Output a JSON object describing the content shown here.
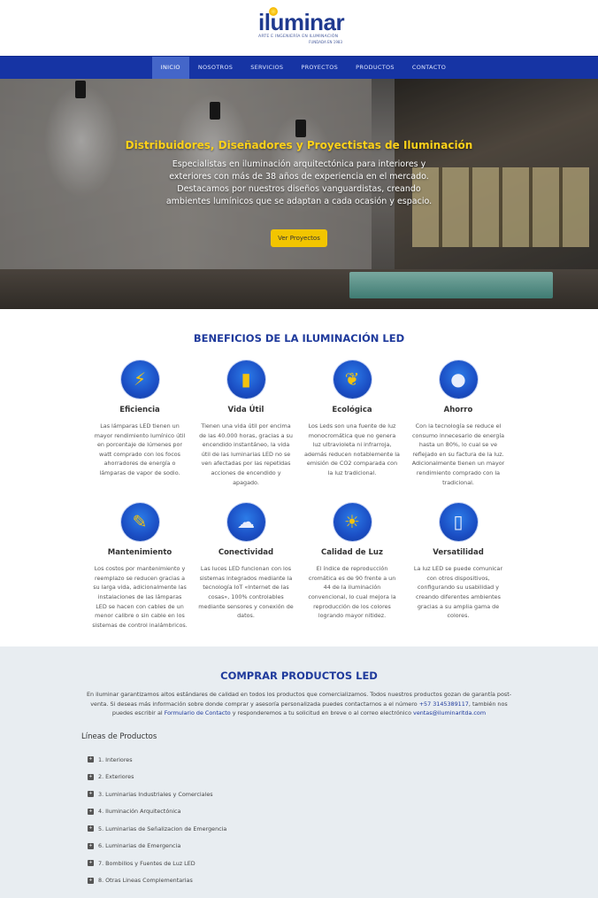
{
  "brand": {
    "name": "iluminar",
    "tagline": "ARTE E INGENIERÍA EN ILUMINACIÓN",
    "founded": "FUNDADA EN 1983"
  },
  "nav": {
    "items": [
      {
        "label": "INICIO",
        "active": true
      },
      {
        "label": "NOSOTROS"
      },
      {
        "label": "SERVICIOS"
      },
      {
        "label": "PROYECTOS"
      },
      {
        "label": "PRODUCTOS"
      },
      {
        "label": "CONTACTO"
      }
    ]
  },
  "hero": {
    "title": "Distribuidores, Diseñadores y Proyectistas de Iluminación",
    "text": "Especialistas en iluminación arquitectónica para interiores y exteriores con más de 38 años de experiencia en el mercado. Destacamos por nuestros diseños vanguardistas, creando ambientes lumínicos que se adaptan a cada ocasión y espacio.",
    "button": "Ver Proyectos"
  },
  "benefits": {
    "title": "BENEFICIOS DE LA ILUMINACIÓN LED",
    "items": [
      {
        "icon": "energy-efficiency-icon",
        "title": "Eficiencia",
        "text": "Las lámparas LED tienen un mayor rendimiento lumínico útil en porcentaje de lúmenes por watt comprado con los focos ahorradores de energía o lámparas de vapor de sodio."
      },
      {
        "icon": "battery-life-icon",
        "title": "Vida Útil",
        "text": "Tienen una vida útil por encima de las 40.000 horas, gracias a su encendido instantáneo, la vida útil de las luminarias LED no se ven afectadas por las repetidas acciones de encendido y apagado."
      },
      {
        "icon": "eco-bulb-icon",
        "title": "Ecológica",
        "text": "Los Leds son una fuente de luz monocromática que no genera luz ultravioleta ni infrarroja, además reducen notablemente la emisión de CO2 comparada con la luz tradicional."
      },
      {
        "icon": "savings-bulb-icon",
        "title": "Ahorro",
        "text": "Con la tecnología se reduce el consumo innecesario de energía hasta un 80%, lo cual se ve reflejado en su factura de la luz. Adicionalmente tienen un mayor rendimiento comprado con la tradicional."
      },
      {
        "icon": "maintenance-icon",
        "title": "Mantenimiento",
        "text": "Los costos por mantenimiento y reemplazo se reducen gracias a su larga vida, adicionalmente las instalaciones de las lámparas LED se hacen con cables de un menor calibre o sin cable en los sistemas de control inalámbricos."
      },
      {
        "icon": "connectivity-icon",
        "title": "Conectividad",
        "text": "Las luces LED funcionan con los sistemas integrados mediante la tecnología IoT «Internet de las cosas», 100% controlables mediante sensores y conexión de datos."
      },
      {
        "icon": "light-quality-icon",
        "title": "Calidad de Luz",
        "text": "El índice de reproducción cromática es de 90 frente a un 44 de la iluminación convencional, lo cual mejora la reproducción de los colores logrando mayor nitidez."
      },
      {
        "icon": "versatility-icon",
        "title": "Versatilidad",
        "text": "La luz LED se puede comunicar con otros dispositivos, configurando su usabilidad y creando diferentes ambientes gracias a su amplia gama de colores."
      }
    ]
  },
  "buy": {
    "title": "COMPRAR PRODUCTOS LED",
    "text_1": "En iluminar garantizamos altos estándares de calidad en todos los productos que comercializamos. Todos nuestros productos gozan de garantía post-venta. Si deseas más información sobre donde comprar y asesoría personalizada puedes contactarnos a el número",
    "phone": "+57 3145389117",
    "text_2": ", también nos puedes escribir al",
    "form_link": "Formulario de Contacto",
    "text_3": "y responderemos a tu solicitud en breve o al correo electrónico",
    "email": "ventas@iluminarltda.com",
    "lines_title": "Líneas de Productos",
    "lines": [
      "1. Interiores",
      "2. Exteriores",
      "3. Luminarias Industriales y Comerciales",
      "4. Iluminación Arquitectónica",
      "5. Luminarias de Señalizacion de Emergencia",
      "6. Luminarias de Emergencia",
      "7. Bombillos y Fuentes de Luz LED",
      "8. Otras Lineas Complementarias"
    ]
  }
}
